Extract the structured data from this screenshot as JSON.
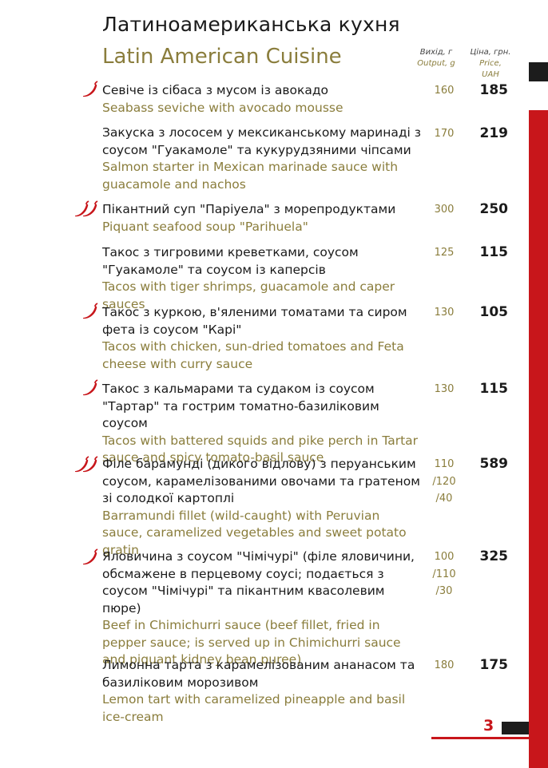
{
  "header": {
    "title_ua": "Латиноамериканська кухня",
    "title_en": "Latin American Cuisine",
    "output_ua": "Вихід, г",
    "output_en": "Output, g",
    "price_ua": "Ціна, грн.",
    "price_en": "Price, UAH"
  },
  "items": [
    {
      "ua": "Севіче із сібаса з мусом із авокадо",
      "en": "Seabass seviche with avocado mousse",
      "output": "160",
      "price": "185",
      "spicy": 1
    },
    {
      "ua": "Закуска з лососем у мексиканському маринаді з соусом \"Гуакамоле\" та кукурудзяними чіпсами",
      "en": "Salmon starter in Mexican marinade sauce with guacamole and nachos",
      "output": "170",
      "price": "219",
      "spicy": 0
    },
    {
      "ua": "Пікантний суп \"Паріуела\" з морепродуктами",
      "en": "Piquant seafood soup \"Parihuela\"",
      "output": "300",
      "price": "250",
      "spicy": 2
    },
    {
      "ua": "Такос з тигровими креветками, соусом \"Гуакамоле\" та соусом із каперсів",
      "en": "Tacos with tiger shrimps, guacamole and caper sauces",
      "output": "125",
      "price": "115",
      "spicy": 0
    },
    {
      "ua": "Такос з куркою, в'яленими томатами та сиром фета із соусом \"Карі\"",
      "en": "Tacos with chicken, sun-dried tomatoes and Feta cheese with curry sauce",
      "output": "130",
      "price": "105",
      "spicy": 1
    },
    {
      "ua": "Такос з кальмарами та судаком із соусом \"Тартар\" та гострим томатно-базиліковим соусом",
      "en": "Tacos with battered squids and pike perch in Tartar sauce and spicy tomato-basil sauce",
      "output": "130",
      "price": "115",
      "spicy": 1
    },
    {
      "ua": "Філе барамунді (дикого відлову) з перуанським соусом, карамелізованими овочами та гратеном зі солодкої картоплі",
      "en": "Barramundi fillet (wild-caught) with Peruvian sauce, caramelized vegetables and sweet potato gratin",
      "output_lines": [
        "110",
        "/120",
        "/40"
      ],
      "price": "589",
      "spicy": 2
    },
    {
      "ua": "Яловичина з соусом \"Чімічурі\" (філе яловичини, обсмажене в перцевому соусі; подається з соусом \"Чімічурі\" та пікантним квасолевим пюре)",
      "en": "Beef in Chimichurri sauce (beef fillet, fried in pepper sauce; is served up in Chimichurri sauce and piquant kidney bean puree)",
      "output_lines": [
        "100",
        "/110",
        "/30"
      ],
      "price": "325",
      "spicy": 1
    },
    {
      "ua": "Лимонна тарта з карамелізованим ананасом та базиліковим морозивом",
      "en": "Lemon tart with caramelized pineapple and basil ice-cream",
      "output": "180",
      "price": "175",
      "spicy": 0
    }
  ],
  "page_number": "3",
  "colors": {
    "accent_red": "#c8161b",
    "olive": "#8a7d3c",
    "text": "#1a1a1a"
  },
  "icons": {
    "spicy": "chili-pepper-icon"
  }
}
